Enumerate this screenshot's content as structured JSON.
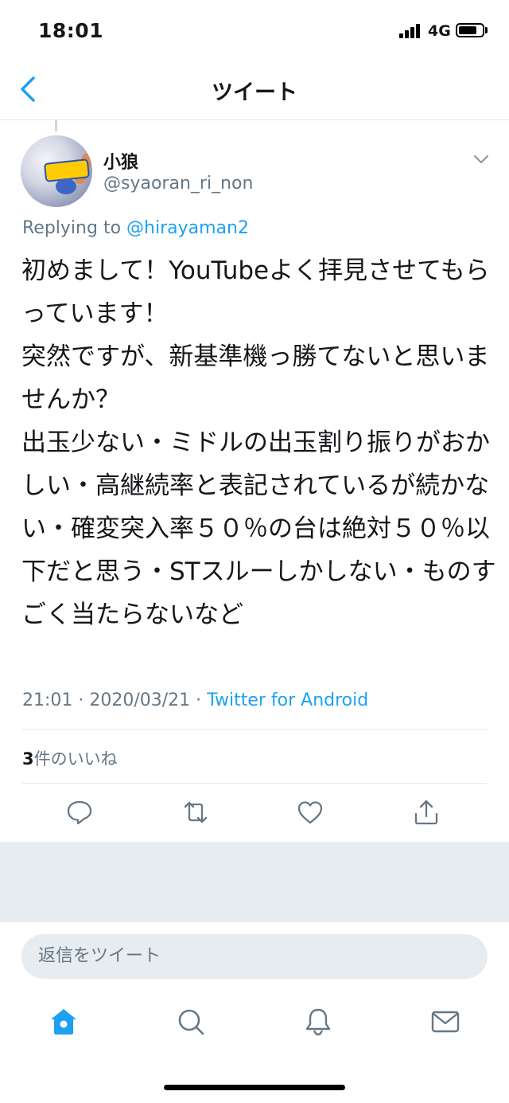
{
  "status_bar": {
    "time": "18:01",
    "network": "4G",
    "battery_level": 0.78
  },
  "nav": {
    "title": "ツイート",
    "back_icon": "chevron-left-icon"
  },
  "tweet": {
    "author": {
      "display_name": "小狼",
      "handle": "@syaoran_ri_non",
      "avatar_badge": "Pokémon GO"
    },
    "replying_prefix": "Replying to",
    "replying_to": "@hirayaman2",
    "text": "初めまして！YouTubeよく拝見させてもらっています！\n突然ですが、新基準機っ勝てないと思いませんか？\n出玉少ない・ミドルの出玉割り振りがおかしい・高継続率と表記されているが続かない・確変突入率５０％の台は絶対５０％以下だと思う・STスルーしかしない・ものすごく当たらないなど",
    "timestamp": "21:01 · 2020/03/21 · ",
    "source": "Twitter for Android",
    "likes_count": "3",
    "likes_label": "件のいいね"
  },
  "actions": [
    {
      "name": "reply",
      "icon": "comment-icon"
    },
    {
      "name": "retweet",
      "icon": "retweet-icon"
    },
    {
      "name": "like",
      "icon": "heart-icon"
    },
    {
      "name": "share",
      "icon": "share-icon"
    }
  ],
  "reply_box": {
    "placeholder": "返信をツイート"
  },
  "tab_bar": [
    {
      "name": "home",
      "icon": "home-icon",
      "active": true
    },
    {
      "name": "search",
      "icon": "search-icon",
      "active": false
    },
    {
      "name": "notifications",
      "icon": "bell-icon",
      "active": false
    },
    {
      "name": "messages",
      "icon": "mail-icon",
      "active": false
    }
  ],
  "colors": {
    "accent": "#1da1f2",
    "secondary_text": "#657786",
    "divider": "#e1e8ed",
    "band": "#e6ecf0"
  }
}
